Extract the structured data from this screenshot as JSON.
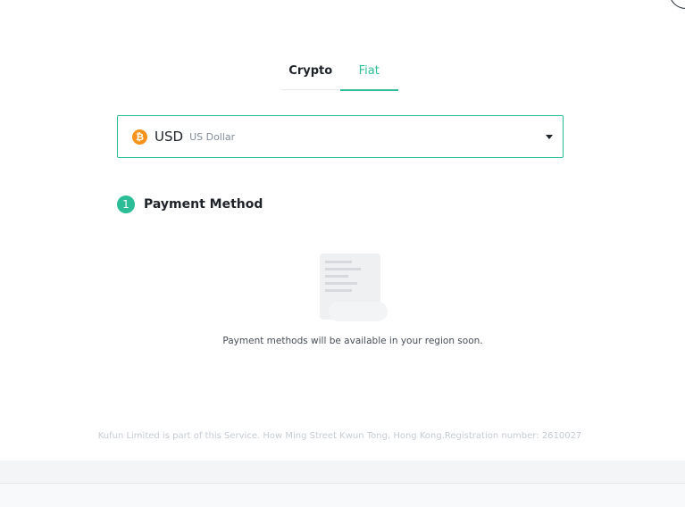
{
  "tabs": {
    "crypto": "Crypto",
    "fiat": "Fiat",
    "active": "Fiat"
  },
  "currency": {
    "icon": "bitcoin-icon",
    "code": "USD",
    "name": "US Dollar"
  },
  "payment": {
    "step_number": "1",
    "title": "Payment Method",
    "empty_message": "Payment methods will be available in your region soon."
  },
  "footer": {
    "note": "Kufun Limited is part of this Service. How Ming Street Kwun Tong, Hong Kong.Registration number: 2610027"
  },
  "colors": {
    "accent": "#2dbd96",
    "coin": "#f7931a",
    "text": "#1e2329",
    "muted": "#848e9c"
  }
}
